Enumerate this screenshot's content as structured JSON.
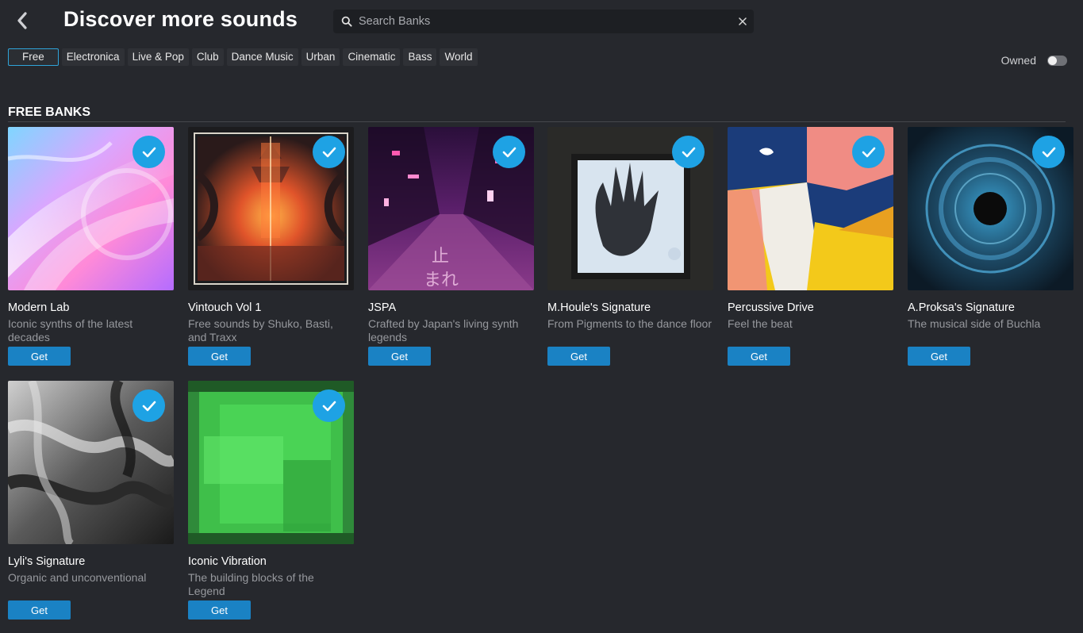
{
  "header": {
    "title": "Discover more sounds",
    "search_placeholder": "Search Banks",
    "search_value": ""
  },
  "filters": [
    "Free",
    "Electronica",
    "Live & Pop",
    "Club",
    "Dance Music",
    "Urban",
    "Cinematic",
    "Bass",
    "World"
  ],
  "active_filter": "Free",
  "owned_toggle": {
    "label": "Owned",
    "on": false
  },
  "section": {
    "title": "FREE BANKS"
  },
  "get_label": "Get",
  "banks": [
    {
      "title": "Modern Lab",
      "subtitle": "Iconic synths of the latest decades",
      "owned": true
    },
    {
      "title": "Vintouch Vol 1",
      "subtitle": "Free sounds by Shuko, Basti, and Traxx",
      "owned": true
    },
    {
      "title": "JSPA",
      "subtitle": "Crafted by Japan's living synth legends",
      "owned": true
    },
    {
      "title": "M.Houle's Signature",
      "subtitle": "From Pigments to the dance floor",
      "owned": true
    },
    {
      "title": "Percussive Drive",
      "subtitle": "Feel the beat",
      "owned": true
    },
    {
      "title": "A.Proksa's Signature",
      "subtitle": "The musical side of Buchla",
      "owned": true
    },
    {
      "title": "Lyli's Signature",
      "subtitle": "Organic and unconventional",
      "owned": true
    },
    {
      "title": "Iconic Vibration",
      "subtitle": "The building blocks of the Legend",
      "owned": true
    }
  ],
  "colors": {
    "accent": "#1ea2e4",
    "button": "#1a82c4",
    "background": "#26282d"
  }
}
